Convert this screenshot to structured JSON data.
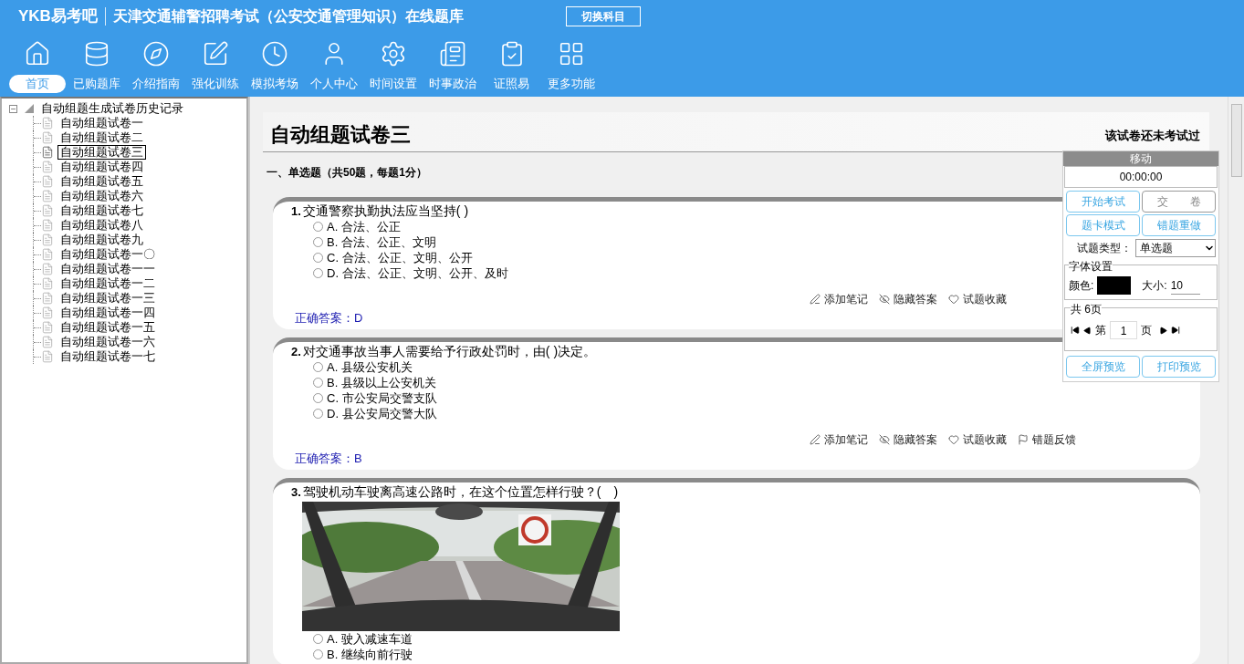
{
  "header": {
    "logo": "YKB易考吧",
    "title": "天津交通辅警招聘考试（公安交通管理知识）在线题库",
    "switch_button": "切换科目"
  },
  "toolbar": [
    {
      "kind": "home",
      "label": "首页",
      "selected": true
    },
    {
      "kind": "database",
      "label": "已购题库",
      "selected": false
    },
    {
      "kind": "compass",
      "label": "介绍指南",
      "selected": false
    },
    {
      "kind": "edit",
      "label": "强化训练",
      "selected": false
    },
    {
      "kind": "clock",
      "label": "模拟考场",
      "selected": false
    },
    {
      "kind": "user",
      "label": "个人中心",
      "selected": false
    },
    {
      "kind": "gear",
      "label": "时间设置",
      "selected": false
    },
    {
      "kind": "news",
      "label": "时事政治",
      "selected": false
    },
    {
      "kind": "checklist",
      "label": "证照易",
      "selected": false
    },
    {
      "kind": "grid",
      "label": "更多功能",
      "selected": false
    }
  ],
  "tree": {
    "label": "自动组题生成试卷历史记录",
    "expanded": true,
    "children": [
      {
        "label": "自动组题试卷一",
        "selected": false
      },
      {
        "label": "自动组题试卷二",
        "selected": false
      },
      {
        "label": "自动组题试卷三",
        "selected": true
      },
      {
        "label": "自动组题试卷四",
        "selected": false
      },
      {
        "label": "自动组题试卷五",
        "selected": false
      },
      {
        "label": "自动组题试卷六",
        "selected": false
      },
      {
        "label": "自动组题试卷七",
        "selected": false
      },
      {
        "label": "自动组题试卷八",
        "selected": false
      },
      {
        "label": "自动组题试卷九",
        "selected": false
      },
      {
        "label": "自动组题试卷一〇",
        "selected": false
      },
      {
        "label": "自动组题试卷一一",
        "selected": false
      },
      {
        "label": "自动组题试卷一二",
        "selected": false
      },
      {
        "label": "自动组题试卷一三",
        "selected": false
      },
      {
        "label": "自动组题试卷一四",
        "selected": false
      },
      {
        "label": "自动组题试卷一五",
        "selected": false
      },
      {
        "label": "自动组题试卷一六",
        "selected": false
      },
      {
        "label": "自动组题试卷一七",
        "selected": false
      }
    ]
  },
  "paper": {
    "title": "自动组题试卷三",
    "status": "该试卷还未考试过",
    "section": "一、单选题（共50题，每题1分）",
    "questions": [
      {
        "number": "1.",
        "text": "交通警察执勤执法应当坚持( )",
        "options": [
          {
            "label": "A. 合法、公正",
            "selected": false
          },
          {
            "label": "B. 合法、公正、文明",
            "selected": false
          },
          {
            "label": "C. 合法、公正、文明、公开",
            "selected": false
          },
          {
            "label": "D. 合法、公正、文明、公开、及时",
            "selected": false
          }
        ],
        "actions": [
          {
            "kind": "note",
            "label": "添加笔记"
          },
          {
            "kind": "hide",
            "label": "隐藏答案"
          },
          {
            "kind": "fav",
            "label": "试题收藏"
          }
        ],
        "answer": "正确答案：D"
      },
      {
        "number": "2.",
        "text": "对交通事故当事人需要给予行政处罚时，由( )决定。",
        "options": [
          {
            "label": "A. 县级公安机关",
            "selected": false
          },
          {
            "label": "B. 县级以上公安机关",
            "selected": false
          },
          {
            "label": "C. 市公安局交警支队",
            "selected": false
          },
          {
            "label": "D. 县公安局交警大队",
            "selected": false
          }
        ],
        "actions": [
          {
            "kind": "note",
            "label": "添加笔记"
          },
          {
            "kind": "hide",
            "label": "隐藏答案"
          },
          {
            "kind": "fav",
            "label": "试题收藏"
          },
          {
            "kind": "report",
            "label": "错题反馈"
          }
        ],
        "answer": "正确答案：B"
      },
      {
        "number": "3.",
        "text": "驾驶机动车驶离高速公路时，在这个位置怎样行驶？(　)",
        "picture": {
          "kind": "picture"
        },
        "options": [
          {
            "label": "A. 驶入减速车道",
            "selected": false
          },
          {
            "label": "B. 继续向前行驶",
            "selected": false
          }
        ]
      }
    ]
  },
  "panel": {
    "title": "移动",
    "timer": "00:00:00",
    "buttons": [
      {
        "label": "开始考试",
        "disabled": false
      },
      {
        "label": "交　　卷",
        "disabled": true
      },
      {
        "label": "题卡模式",
        "disabled": false
      },
      {
        "label": "错题重做",
        "disabled": false
      }
    ],
    "type_label": "试题类型：",
    "type_value": "单选题",
    "font_group": "字体设置",
    "color_label": "颜色:",
    "color": "#000000",
    "size_label": "大小:",
    "size_value": "10",
    "page_group": "共 6页",
    "page_prefix": "第",
    "page_value": "1",
    "page_suffix": "页",
    "bottom_buttons": [
      "全屏预览",
      "打印预览"
    ]
  }
}
